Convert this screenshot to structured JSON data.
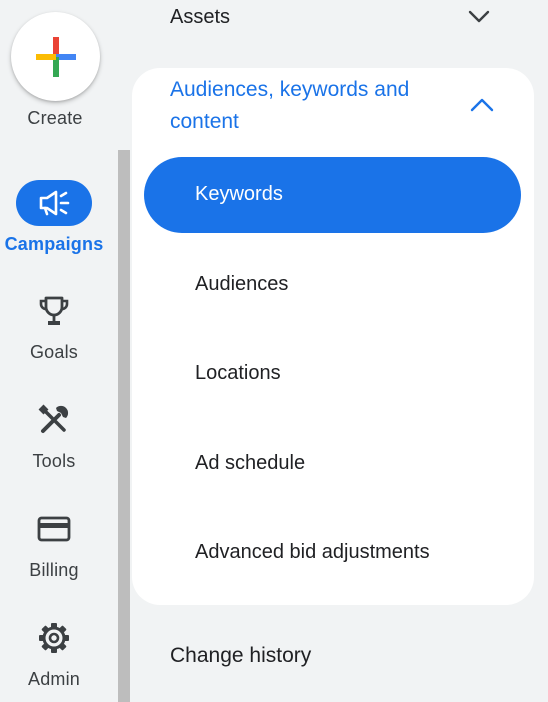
{
  "rail": {
    "create_label": "Create",
    "items": [
      {
        "label": "Campaigns",
        "icon": "megaphone-icon",
        "active": true
      },
      {
        "label": "Goals",
        "icon": "trophy-icon",
        "active": false
      },
      {
        "label": "Tools",
        "icon": "tools-icon",
        "active": false
      },
      {
        "label": "Billing",
        "icon": "credit-card-icon",
        "active": false
      },
      {
        "label": "Admin",
        "icon": "gear-icon",
        "active": false
      }
    ]
  },
  "menu": {
    "assets_label": "Assets",
    "section_title": "Audiences, keywords and content",
    "sub_items": [
      {
        "label": "Keywords",
        "selected": true
      },
      {
        "label": "Audiences",
        "selected": false
      },
      {
        "label": "Locations",
        "selected": false
      },
      {
        "label": "Ad schedule",
        "selected": false
      },
      {
        "label": "Advanced bid adjustments",
        "selected": false
      }
    ],
    "change_history_label": "Change history"
  },
  "colors": {
    "accent": "#1a73e8",
    "background": "#f1f3f4",
    "card": "#ffffff",
    "text": "#202124"
  }
}
